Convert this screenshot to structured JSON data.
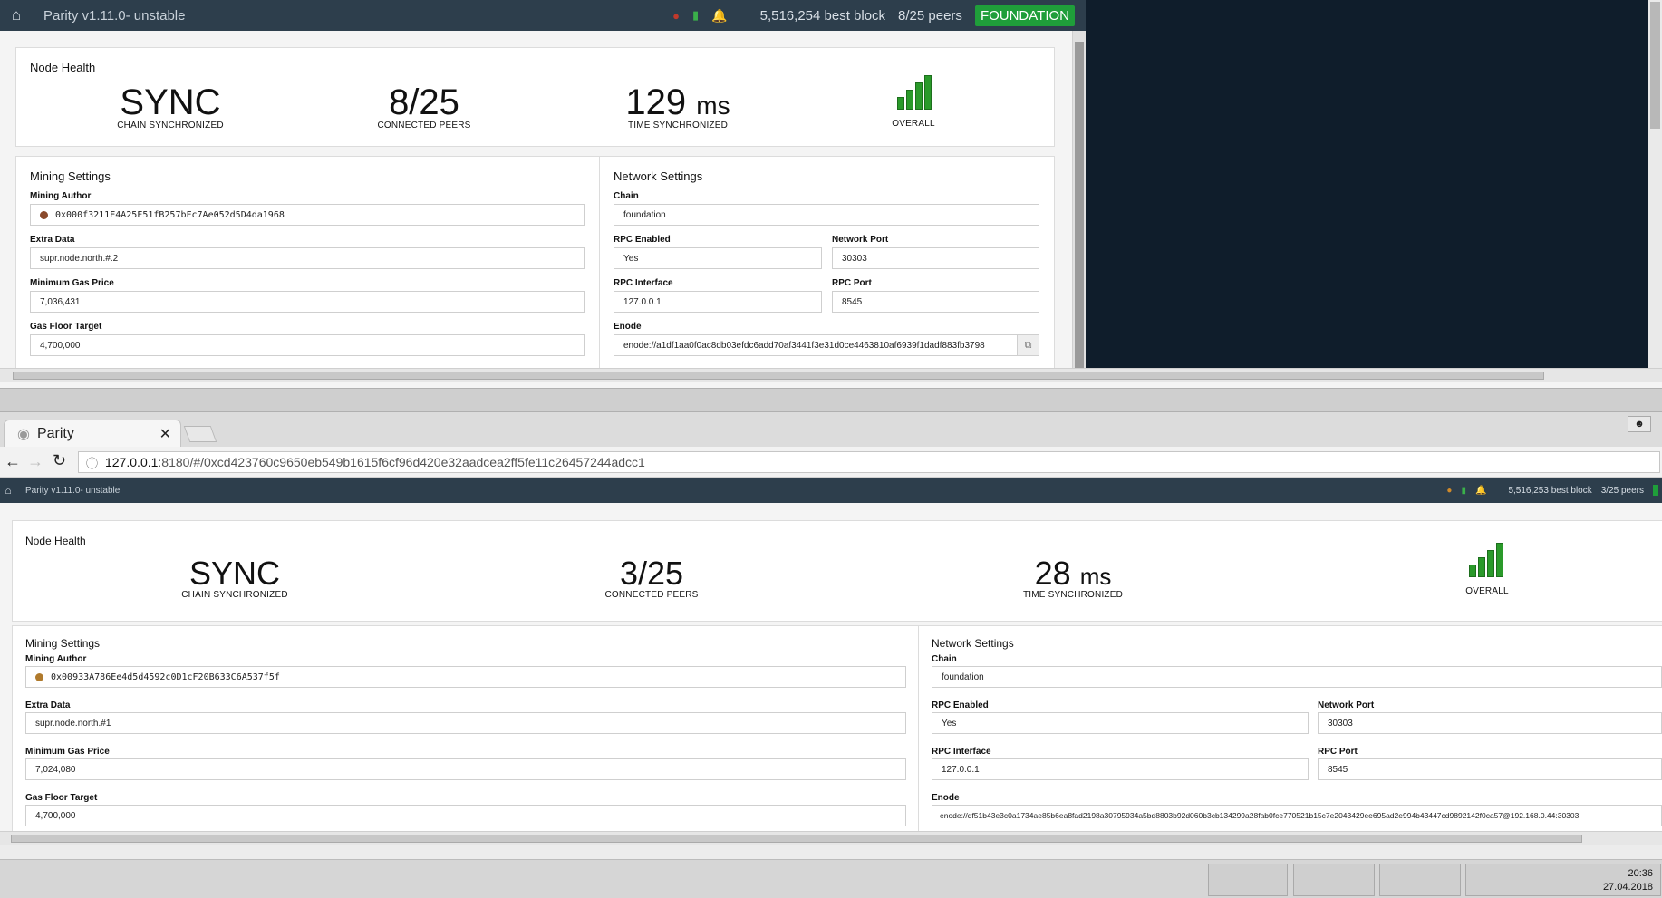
{
  "top": {
    "app_title": "Parity v1.11.0- unstable",
    "best_block": "5,516,254 best block",
    "peers": "8/25 peers",
    "badge": "FOUNDATION",
    "health": {
      "title": "Node Health",
      "sync": "SYNC",
      "sync_label": "CHAIN SYNCHRONIZED",
      "peers": "8/25",
      "peers_label": "CONNECTED PEERS",
      "time": "129",
      "time_unit": "ms",
      "time_label": "TIME SYNCHRONIZED",
      "overall_label": "OVERALL"
    },
    "mining": {
      "title": "Mining Settings",
      "author_label": "Mining Author",
      "author": "0x000f3211E4A25F51fB257bFc7Ae052d5D4da1968",
      "extra_label": "Extra Data",
      "extra": "supr.node.north.#.2",
      "gas_price_label": "Minimum Gas Price",
      "gas_price": "7,036,431",
      "floor_label": "Gas Floor Target",
      "floor": "4,700,000"
    },
    "network": {
      "title": "Network Settings",
      "chain_label": "Chain",
      "chain": "foundation",
      "rpc_enabled_label": "RPC Enabled",
      "rpc_enabled": "Yes",
      "port_label": "Network Port",
      "port": "30303",
      "rpc_iface_label": "RPC Interface",
      "rpc_iface": "127.0.0.1",
      "rpc_port_label": "RPC Port",
      "rpc_port": "8545",
      "enode_label": "Enode",
      "enode": "enode://a1df1aa0f0ac8db03efdc6add70af3441f3e31d0ce4463810af6939f1dadf883fb3798"
    }
  },
  "browser": {
    "tab_title": "Parity",
    "url_host": "127.0.0.1",
    "url_rest": ":8180/#/0xcd423760c9650eb549b1615f6cf96d420e32aadcea2ff5fe11c26457244adcc1"
  },
  "bottom": {
    "app_title": "Parity v1.11.0- unstable",
    "best_block": "5,516,253 best block",
    "peers": "3/25 peers",
    "health": {
      "title": "Node Health",
      "sync": "SYNC",
      "sync_label": "CHAIN SYNCHRONIZED",
      "peers": "3/25",
      "peers_label": "CONNECTED PEERS",
      "time": "28",
      "time_unit": "ms",
      "time_label": "TIME SYNCHRONIZED",
      "overall_label": "OVERALL"
    },
    "mining": {
      "title": "Mining Settings",
      "author_label": "Mining Author",
      "author": "0x00933A786Ee4d5d4592c0D1cF20B633C6A537f5f",
      "extra_label": "Extra Data",
      "extra": "supr.node.north.#1",
      "gas_price_label": "Minimum Gas Price",
      "gas_price": "7,024,080",
      "floor_label": "Gas Floor Target",
      "floor": "4,700,000"
    },
    "network": {
      "title": "Network Settings",
      "chain_label": "Chain",
      "chain": "foundation",
      "rpc_enabled_label": "RPC Enabled",
      "rpc_enabled": "Yes",
      "port_label": "Network Port",
      "port": "30303",
      "rpc_iface_label": "RPC Interface",
      "rpc_iface": "127.0.0.1",
      "rpc_port_label": "RPC Port",
      "rpc_port": "8545",
      "enode_label": "Enode",
      "enode": "enode://df51b43e3c0a1734ae85b6ea8fad2198a30795934a5bd8803b92d060b3cb134299a28fab0fce770521b15c7e2043429ee695ad2e994b43447cd9892142f0ca57@192.168.0.44:30303"
    }
  },
  "clock": {
    "time": "20:36",
    "date": "27.04.2018"
  },
  "colors": {
    "appbar": "#2d3e4c",
    "badge": "#1f9e3a",
    "dark_panel": "#0f1d2b"
  }
}
